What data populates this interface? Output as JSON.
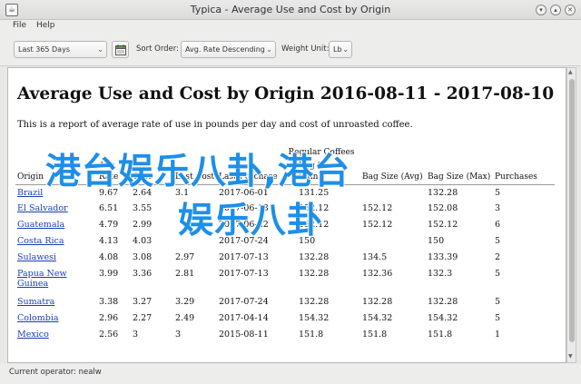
{
  "window": {
    "title": "Typica - Average Use and Cost by Origin",
    "icon": "app-icon"
  },
  "menu": {
    "items": [
      "File",
      "Help"
    ]
  },
  "toolbar": {
    "date_range": "Last 365 Days",
    "sort_label": "Sort Order:",
    "sort_value": "Avg. Rate Descending",
    "unit_label": "Weight Unit:",
    "unit_value": "Lb"
  },
  "report": {
    "title": "Average Use and Cost by Origin 2016-08-11 - 2017-08-10",
    "subtitle": "This is a report of average rate of use in pounds per day and cost of unroasted coffee.",
    "group_header": "Regular Coffees",
    "columns": [
      "Origin",
      "Avg. Rate",
      "Avg. Cost",
      "Last Cost",
      "Last Purchase",
      "Bag Size (Min)",
      "Bag Size (Avg)",
      "Bag Size (Max)",
      "Purchases"
    ],
    "rows": [
      [
        "Brazil",
        "9.67",
        "2.64",
        "3.1",
        "2017-06-01",
        "131.25",
        "",
        "132.28",
        "5"
      ],
      [
        "El Salvador",
        "6.51",
        "3.55",
        "",
        "2017-06-13",
        "152.12",
        "152.12",
        "152.08",
        "3"
      ],
      [
        "Guatemala",
        "4.79",
        "2.99",
        "",
        "2017-06-22",
        "152.12",
        "152.12",
        "152.12",
        "6"
      ],
      [
        "Costa Rica",
        "4.13",
        "4.03",
        "",
        "2017-07-24",
        "150",
        "",
        "150",
        "5"
      ],
      [
        "Sulawesi",
        "4.08",
        "3.08",
        "2.97",
        "2017-07-13",
        "132.28",
        "134.5",
        "133.39",
        "2"
      ],
      [
        "Papua New Guinea",
        "3.99",
        "3.36",
        "2.81",
        "2017-07-13",
        "132.28",
        "132.36",
        "132.3",
        "5"
      ],
      [
        "Sumatra",
        "3.38",
        "3.27",
        "3.29",
        "2017-07-24",
        "132.28",
        "132.28",
        "132.28",
        "5"
      ],
      [
        "Colombia",
        "2.96",
        "2.27",
        "2.49",
        "2017-04-14",
        "154.32",
        "154.32",
        "154.32",
        "5"
      ],
      [
        "Mexico",
        "2.56",
        "3",
        "3",
        "2015-08-11",
        "151.8",
        "151.8",
        "151.8",
        "1"
      ]
    ]
  },
  "status": {
    "text": "Current operator: nealw"
  },
  "overlay": {
    "line1": "港台娱乐八卦,港台",
    "line2": "娱乐八卦"
  }
}
